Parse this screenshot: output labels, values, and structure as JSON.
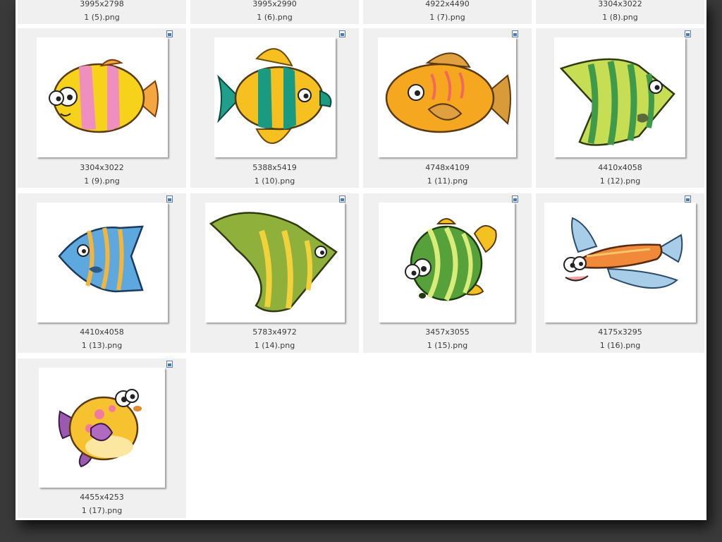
{
  "top_row": [
    {
      "dims": "3995x2798",
      "name": "1 (5).png"
    },
    {
      "dims": "3995x2990",
      "name": "1 (6).png"
    },
    {
      "dims": "4922x4490",
      "name": "1 (7).png"
    },
    {
      "dims": "3304x3022",
      "name": "1 (8).png"
    }
  ],
  "files": [
    {
      "dims": "3304x3022",
      "name": "1 (9).png",
      "icon": "clownfish-icon"
    },
    {
      "dims": "5388x5419",
      "name": "1 (10).png",
      "icon": "angelfish-icon"
    },
    {
      "dims": "4748x4109",
      "name": "1 (11).png",
      "icon": "goldfish-icon"
    },
    {
      "dims": "4410x4058",
      "name": "1 (12).png",
      "icon": "striped-angelfish-icon"
    },
    {
      "dims": "4410x4058",
      "name": "1 (13).png",
      "icon": "blue-fish-icon"
    },
    {
      "dims": "5783x4972",
      "name": "1 (14).png",
      "icon": "moorish-idol-icon"
    },
    {
      "dims": "3457x3055",
      "name": "1 (15).png",
      "icon": "green-pufferfish-icon"
    },
    {
      "dims": "4175x3295",
      "name": "1 (16).png",
      "icon": "flying-fish-icon"
    },
    {
      "dims": "4455x4253",
      "name": "1 (17).png",
      "icon": "yellow-pufferfish-icon"
    }
  ]
}
